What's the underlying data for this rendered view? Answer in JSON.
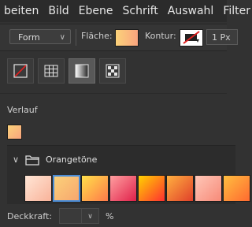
{
  "menubar": {
    "items": [
      "beiten",
      "Bild",
      "Ebene",
      "Schrift",
      "Auswahl",
      "Filter"
    ]
  },
  "options": {
    "shape_mode": "Form",
    "fill_label": "Fläche:",
    "stroke_label": "Kontur:",
    "stroke_width": "1 Px"
  },
  "fill_type_icons": [
    "no-fill-icon",
    "solid-color-icon",
    "gradient-icon",
    "pattern-icon"
  ],
  "gradient_section": {
    "label": "Verlauf",
    "group_name": "Orangetöne",
    "presets": [
      {
        "from": "#ffe6d6",
        "to": "#f9b39a"
      },
      {
        "from": "#fbd27a",
        "to": "#f7a56e"
      },
      {
        "from": "#ffe04a",
        "to": "#ff7a4a"
      },
      {
        "from": "#ffa0a0",
        "to": "#e0204a"
      },
      {
        "from": "#ffd200",
        "to": "#ff3030"
      },
      {
        "from": "#ffb040",
        "to": "#e0402a"
      },
      {
        "from": "#ffc7b8",
        "to": "#f78a78"
      },
      {
        "from": "#ffbe40",
        "to": "#ff6a30"
      }
    ],
    "selected_index": 1
  },
  "opacity": {
    "label": "Deckkraft:",
    "value": "",
    "unit": "%"
  },
  "colors": {
    "current_fill_from": "#fbd27a",
    "current_fill_to": "#f9a47e",
    "selection": "#4a8cd6"
  }
}
